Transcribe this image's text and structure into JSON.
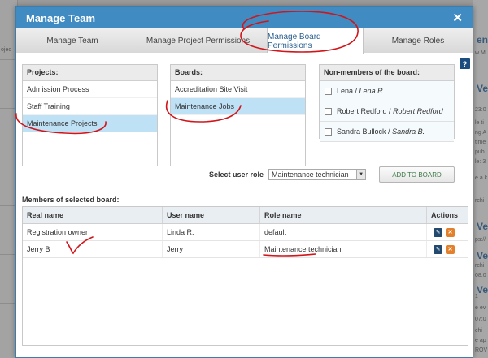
{
  "background": {
    "left_rows": [
      "ojec",
      "",
      "",
      "",
      "",
      ""
    ],
    "right_heads": [
      "ent",
      "Ve",
      "Ve",
      "Ve",
      "Ve"
    ],
    "right_texts": [
      "w M",
      "23:0",
      "le ti",
      "ng A",
      "time",
      "pub",
      "le: 3",
      "e a k",
      "rchi",
      "ps://",
      "rchi",
      "08:0",
      "1",
      "e ev",
      "07:0",
      "chi",
      "e ap",
      "ROV"
    ]
  },
  "modal": {
    "title": "Manage Team",
    "close_glyph": "✕"
  },
  "tabs": [
    {
      "label": "Manage Team"
    },
    {
      "label": "Manage Project Permissions"
    },
    {
      "label": "Manage Board Permissions"
    },
    {
      "label": "Manage Roles"
    }
  ],
  "help_glyph": "?",
  "projects": {
    "header": "Projects:",
    "items": [
      "Admission Process",
      "Staff Training",
      "Maintenance Projects"
    ]
  },
  "boards": {
    "header": "Boards:",
    "items": [
      "Accreditation Site Visit",
      "Maintenance Jobs"
    ]
  },
  "non_members": {
    "header": "Non-members of the board:",
    "items": [
      {
        "name": "Lena",
        "sep": " / ",
        "alias": "Lena R"
      },
      {
        "name": "Robert Redford",
        "sep": " / ",
        "alias": "Robert Redford"
      },
      {
        "name": "Sandra Bullock",
        "sep": " / ",
        "alias": "Sandra B."
      }
    ]
  },
  "role_select": {
    "label": "Select user role",
    "value": "Maintenance technician",
    "arrow": "▼"
  },
  "add_button": "ADD TO BOARD",
  "members": {
    "label": "Members of selected board:",
    "columns": [
      "Real name",
      "User name",
      "Role name",
      "Actions"
    ],
    "rows": [
      {
        "real": "Registration owner",
        "user": "Linda R.",
        "role": "default"
      },
      {
        "real": "Jerry B",
        "user": "Jerry",
        "role": "Maintenance technician"
      }
    ],
    "edit_glyph": "✎",
    "delete_glyph": "✕"
  },
  "colors": {
    "header": "#3f8bc2",
    "selection": "#bfe1f5",
    "annotation": "#d0151b"
  }
}
